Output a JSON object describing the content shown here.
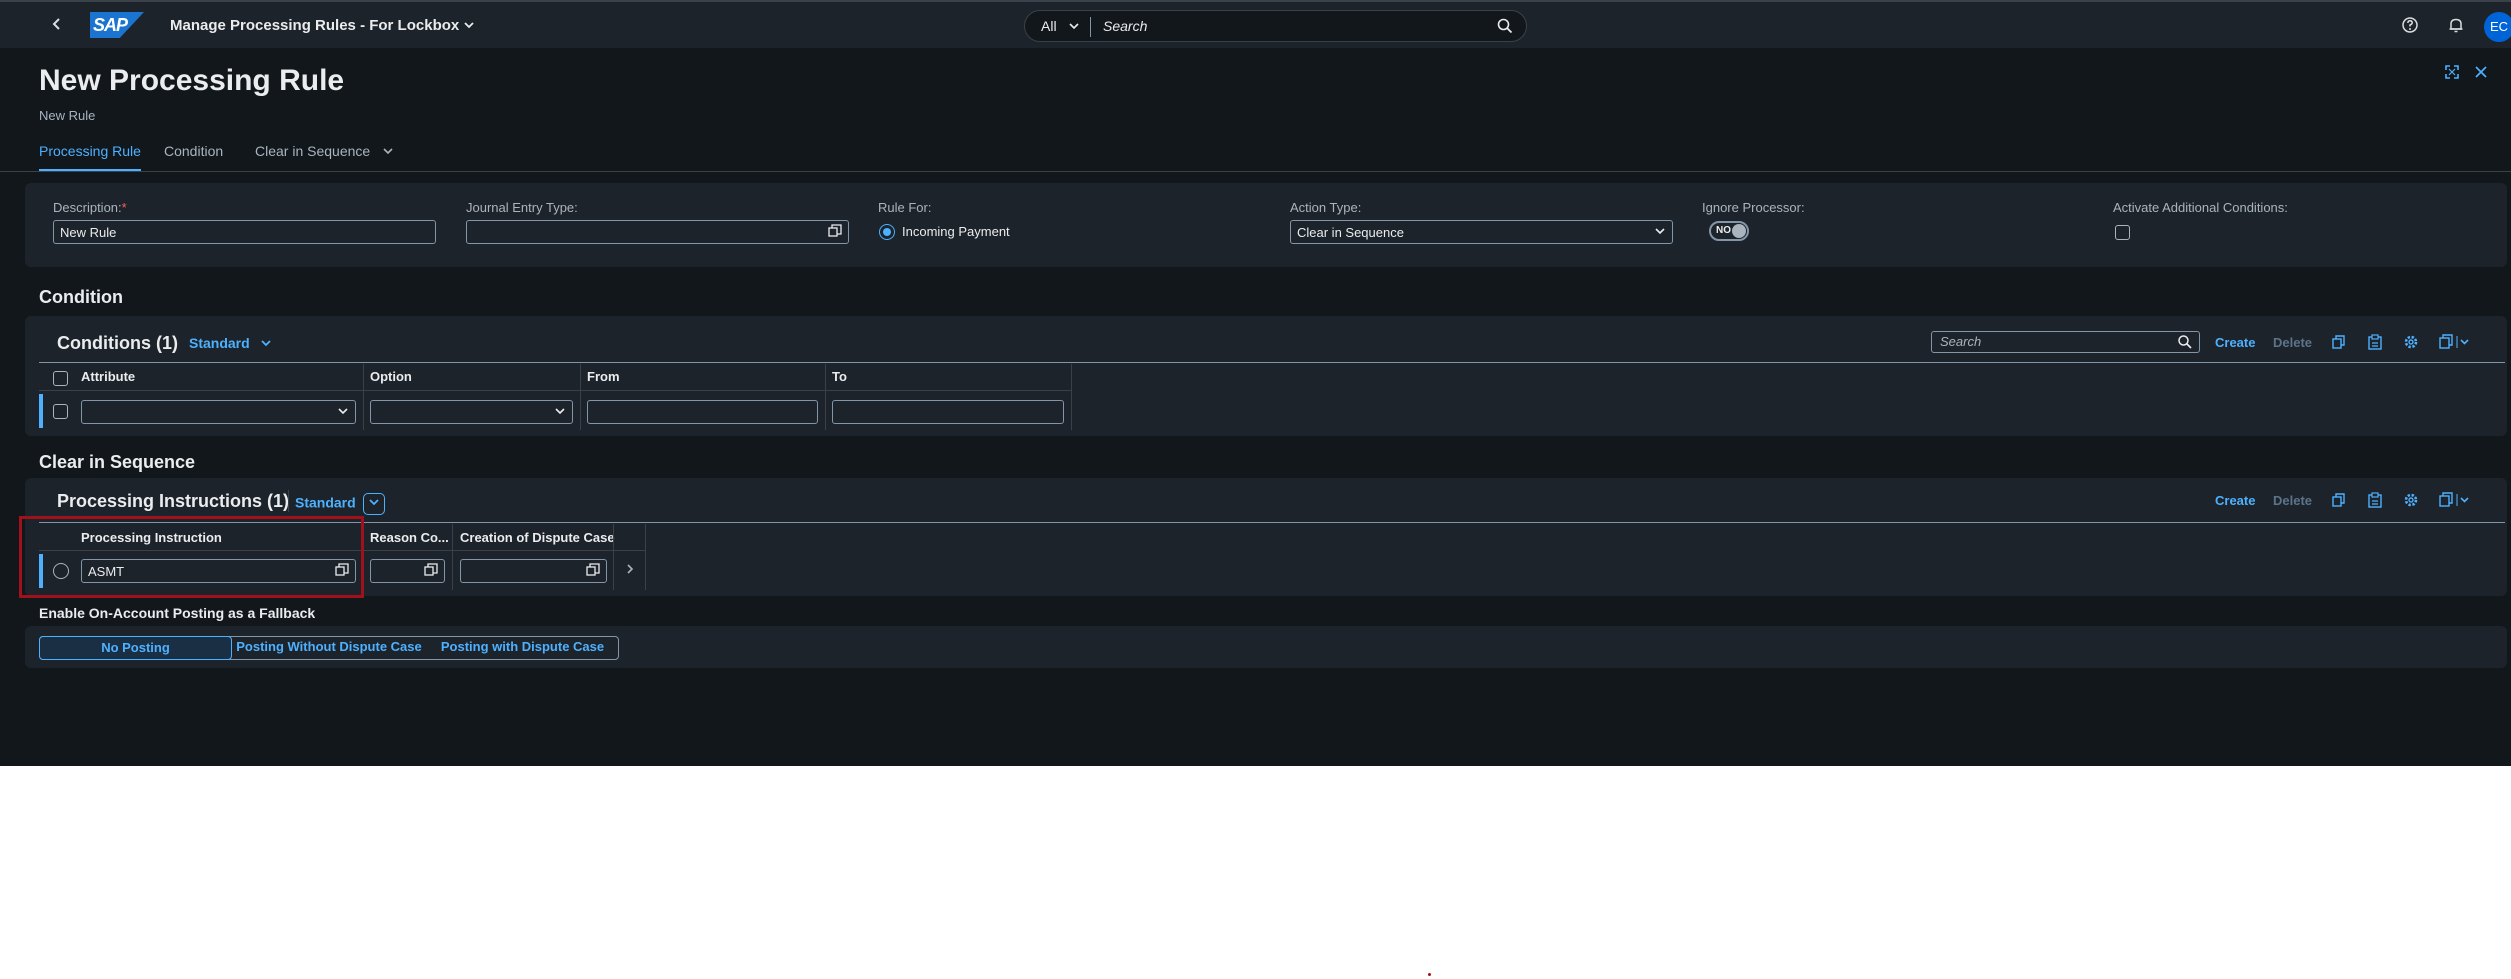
{
  "shell": {
    "logo_text": "SAP",
    "app_title": "Manage Processing Rules - For Lockbox",
    "search_scope": "All",
    "search_placeholder": "Search",
    "avatar_initials": "EC"
  },
  "header": {
    "title": "New Processing Rule",
    "subtitle": "New Rule",
    "tabs": [
      {
        "label": "Processing Rule",
        "active": true
      },
      {
        "label": "Condition",
        "active": false
      },
      {
        "label": "Clear in Sequence",
        "active": false
      }
    ]
  },
  "rule_form": {
    "description_label": "Description:",
    "description_required": "*",
    "description_value": "New Rule",
    "journal_entry_type_label": "Journal Entry Type:",
    "journal_entry_type_value": "",
    "rule_for_label": "Rule For:",
    "rule_for_option": "Incoming Payment",
    "action_type_label": "Action Type:",
    "action_type_value": "Clear in Sequence",
    "ignore_processor_label": "Ignore Processor:",
    "ignore_processor_value": "NO",
    "activate_conditions_label": "Activate Additional Conditions:",
    "activate_conditions_checked": false
  },
  "condition_section": {
    "title": "Condition",
    "table_title": "Conditions (1)",
    "variant": "Standard",
    "search_placeholder": "Search",
    "create_label": "Create",
    "delete_label": "Delete",
    "columns": [
      "Attribute",
      "Option",
      "From",
      "To"
    ],
    "rows": [
      {
        "attribute": "",
        "option": "",
        "from": "",
        "to": ""
      }
    ]
  },
  "clear_sequence_section": {
    "title": "Clear in Sequence",
    "table_title": "Processing Instructions (1)",
    "variant": "Standard",
    "create_label": "Create",
    "delete_label": "Delete",
    "columns": [
      "Processing Instruction",
      "Reason Co...",
      "Creation of Dispute Case"
    ],
    "rows": [
      {
        "processing_instruction": "ASMT",
        "reason_code": "",
        "dispute_case": ""
      }
    ]
  },
  "fallback": {
    "title": "Enable On-Account Posting as a Fallback",
    "options": [
      "No Posting",
      "Posting Without Dispute Case",
      "Posting with Dispute Case"
    ],
    "selected": "No Posting"
  },
  "colors": {
    "background": "#12171c",
    "panel": "#1d232a",
    "accent": "#4db1ff",
    "highlight_box": "#a1111c",
    "brand": "#1b75d0"
  }
}
